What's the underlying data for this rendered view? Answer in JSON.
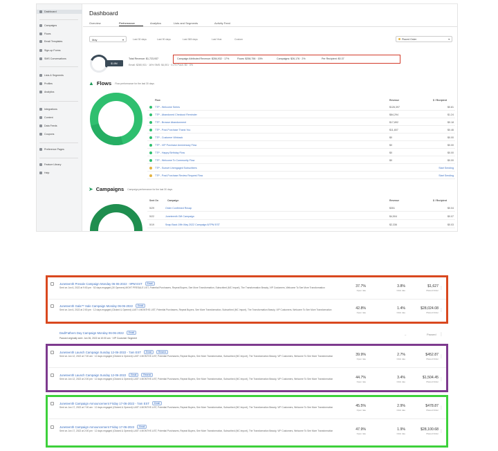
{
  "sidebar": {
    "items": [
      {
        "label": "Dashboard",
        "icon": "home-icon"
      },
      {
        "label": "Campaigns",
        "icon": "megaphone-icon"
      },
      {
        "label": "Flows",
        "icon": "flow-icon"
      },
      {
        "label": "Email Templates",
        "icon": "template-icon"
      },
      {
        "label": "Sign-up Forms",
        "icon": "form-icon"
      },
      {
        "label": "SMS Conversations",
        "icon": "chat-icon"
      },
      {
        "label": "Lists & Segments",
        "icon": "list-icon"
      },
      {
        "label": "Profiles",
        "icon": "person-icon"
      },
      {
        "label": "Analytics",
        "icon": "chart-icon"
      },
      {
        "label": "Integrations",
        "icon": "plug-icon"
      },
      {
        "label": "Content",
        "icon": "image-icon"
      },
      {
        "label": "Data Feeds",
        "icon": "feed-icon"
      },
      {
        "label": "Coupons",
        "icon": "ticket-icon"
      },
      {
        "label": "Preference Pages",
        "icon": "page-icon"
      },
      {
        "label": "Feature Library",
        "icon": "book-icon"
      },
      {
        "label": "Help",
        "icon": "help-icon"
      }
    ]
  },
  "header": {
    "title": "Dashboard",
    "tabs": [
      "Overview",
      "Performance",
      "Analytics",
      "Lists and Segments",
      "Activity Feed"
    ]
  },
  "filters": {
    "date": "May",
    "chips": [
      "Last 30 days",
      "Last 90 days",
      "Last 365 days",
      "Last Year",
      "Custom"
    ],
    "placed_order": "Placed Order"
  },
  "revenue": {
    "badge": "$1.8M",
    "total": "Total Revenue: $1,723,937",
    "campaign": "Campaign Attributed Revenue: $284,932 · 17%",
    "flows": "Flows: $258,756 · 15%",
    "campaigns": "Campaigns: $26,176 · 2%",
    "per_recipient": "Per Recipient: $0.37",
    "breakdown": "Email: $280,931 · 16%   SMS: $4,001 · 0.2%   Push: $0 · 0%"
  },
  "flows": {
    "title": "Flows",
    "subtitle": "Flow performance for the last 30 days",
    "col_flow": "Flow",
    "col_revenue": "Revenue",
    "col_per_recipient": "$ / Recipient",
    "rows": [
      {
        "name": "TTP - Welcome Series",
        "revenue": "$126,397",
        "per": "$0.81",
        "warn": false,
        "link": false
      },
      {
        "name": "TTP - Abandoned Checkout Reminder",
        "revenue": "$84,294",
        "per": "$1.24",
        "warn": false,
        "link": false
      },
      {
        "name": "TTP - Browse Abandonment",
        "revenue": "$17,892",
        "per": "$0.18",
        "warn": false,
        "link": false
      },
      {
        "name": "TTP - Post-Purchase Thank You",
        "revenue": "$11,807",
        "per": "$0.46",
        "warn": false,
        "link": false
      },
      {
        "name": "TTP - Customer Winback",
        "revenue": "$0",
        "per": "$0.00",
        "warn": false,
        "link": false
      },
      {
        "name": "TTP - VIP Purchase Anniversary Flow",
        "revenue": "$0",
        "per": "$0.00",
        "warn": false,
        "link": false
      },
      {
        "name": "TTP - Happy Birthday Flow",
        "revenue": "$0",
        "per": "$0.00",
        "warn": false,
        "link": false
      },
      {
        "name": "TTP - Welcome To Community Flow",
        "revenue": "$0",
        "per": "$0.00",
        "warn": false,
        "link": false
      },
      {
        "name": "TTP - Sunset Unengaged Subscribers",
        "revenue": "",
        "per": "Start Sending",
        "warn": true,
        "link": true
      },
      {
        "name": "TTP - Post-Purchase Review Request Flow",
        "revenue": "",
        "per": "Start Sending",
        "warn": true,
        "link": true
      }
    ]
  },
  "campaigns": {
    "title": "Campaigns",
    "subtitle": "Campaign performance for the last 30 days",
    "col_sent": "Sent On",
    "col_campaign": "Campaign",
    "col_revenue": "Revenue",
    "col_per_recipient": "$ / Recipient",
    "rows": [
      {
        "date": "5/29",
        "name": "Order Confirmed Recap",
        "revenue": "$351",
        "per": "$0.04"
      },
      {
        "date": "5/22",
        "name": "Juneteenth Gift Campaign",
        "revenue": "$4,504",
        "per": "$0.07"
      },
      {
        "date": "5/19",
        "name": "Snap Back 19th May 2022 Campaign 8/7PM EST",
        "revenue": "$2,336",
        "per": "$0.03"
      }
    ]
  },
  "campaign_list": [
    {
      "title": "Juneteenth Presale Campaign Monday 06-06-2022 - 9PM EST",
      "pill": "Email",
      "desc": "Sent on Jun 6, 2022 at 9:00 pm · 52 days engaged (30 Openers) MGHT PRESALE LIST, Potential Purchasers, Repeat Buyers, See More Transformation, Subscribed (MC Import), The Transformation Beauty, VIP Customers, Welcome To See More Transformation",
      "open": "37.7%",
      "open_l": "Open rate",
      "click": "3.8%",
      "click_l": "Click rate",
      "rev": "$1,627",
      "rev_l": "Placed Order"
    },
    {
      "title": "Juneteenth Gala™ Sale Campaign Monday 06-06-2022",
      "pill": "Email",
      "desc": "Sent on Jun 6, 2022 at 2:00 pm · 12 days engaged (Clicked & Opened) LAST 4 MONTHS LIST, Potential Purchasers, Repeat Buyers, See More Transformation, Subscribed (MC Import), The Transformation Beauty, VIP Customers, Welcome To See More Transformation",
      "open": "42.8%",
      "open_l": "Open rate",
      "click": "1.4%",
      "click_l": "Click rate",
      "rev": "$28,024.08",
      "rev_l": "Placed Order"
    }
  ],
  "paused": {
    "title": "Dad/Fathers Day Campaign Monday 06-06-2022",
    "pill": "Email",
    "desc": "Paused originally sent: Jun 06, 2022 at 10:00 am · VIP Customer Segment",
    "dash": "–",
    "status": "Paused"
  },
  "campaign_list_2": [
    {
      "title": "Juneteenth Launch Campaign Sunday 12-06-2022 - 7am EST",
      "pill": "Email",
      "pill2": "Resend",
      "desc": "Sent on Jun 12, 2022 at 7:00 am · 12 days engaged (Clicked & Opened) LAST 4 MONTHS LIST, Potential Purchasers, Repeat Buyers, See More Transformation, Subscribed (MC Import), The Transformation Beauty, VIP Customers, Welcome To See More Transformation",
      "open": "39.9%",
      "open_l": "Open rate",
      "click": "2.7%",
      "click_l": "Click rate",
      "rev": "$452.87",
      "rev_l": "Placed Order"
    },
    {
      "title": "Juneteenth Launch Campaign Sunday 12-06-2022",
      "pill": "Email",
      "pill2": "Resend",
      "desc": "Sent on Jun 12, 2022 at 2:00 pm · 12 days engaged (Clicked & Opened) LAST 4 MONTHS LIST, Potential Purchasers, Repeat Buyers, See More Transformation, Subscribed (MC Import), The Transformation Beauty, VIP Customers, Welcome To See More Transformation",
      "open": "44.7%",
      "open_l": "Open rate",
      "click": "3.4%",
      "click_l": "Click rate",
      "rev": "$1,504.45",
      "rev_l": "Placed Order"
    }
  ],
  "campaign_list_3": [
    {
      "title": "Juneteenth Campaign Announcement Friday 17-06-2022 - 7am EST",
      "pill": "Email",
      "desc": "Sent on Jun 17, 2022 at 7:00 am · 12 days engaged (Clicked & Opened) LAST 4 MONTHS LIST, Potential Purchasers, Repeat Buyers, See More Transformation, Subscribed (MC Import), The Transformation Beauty, VIP Customers, Welcome To See More Transformation",
      "open": "45.5%",
      "open_l": "Open rate",
      "click": "2.9%",
      "click_l": "Click rate",
      "rev": "$478.87",
      "rev_l": "Placed Order"
    },
    {
      "title": "Juneteenth Campaign Announcement Friday 17-06-2022",
      "pill": "Email",
      "desc": "Sent on Jun 17, 2022 at 2:00 pm · 12 days engaged (Clicked & Opened) LAST 4 MONTHS LIST, Potential Purchasers, Repeat Buyers, See More Transformation, Subscribed (MC Import), The Transformation Beauty, VIP Customers, Welcome To See More Transformation",
      "open": "47.9%",
      "open_l": "Open rate",
      "click": "1.9%",
      "click_l": "Click rate",
      "rev": "$28,100.68",
      "rev_l": "Placed Order"
    }
  ],
  "colors": {
    "red_box": "#d9481f",
    "purple_box": "#7d3a8e",
    "green_box": "#3dd13b",
    "flows_green": "#2fbf6f",
    "link_blue": "#3a6fc2"
  }
}
